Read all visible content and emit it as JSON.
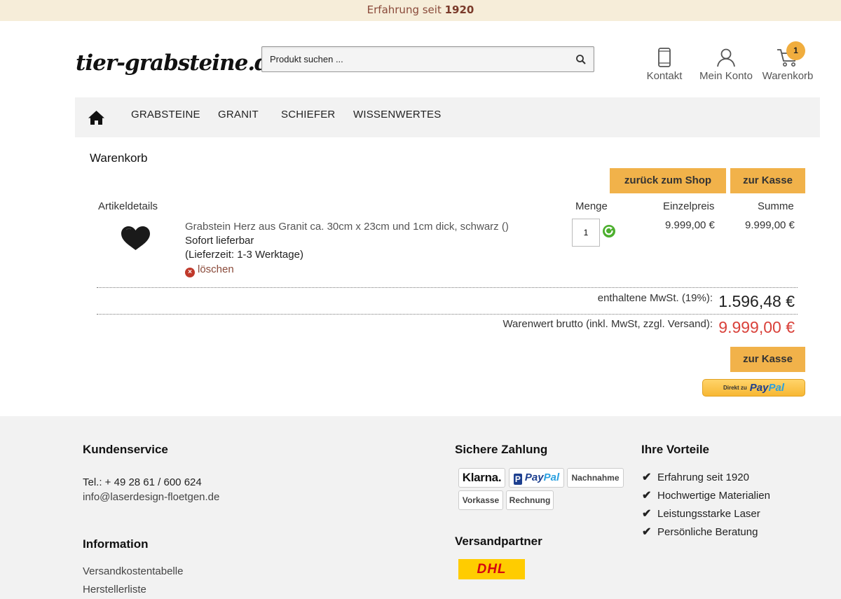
{
  "topbar": {
    "text_prefix": "Erfahrung seit",
    "year": "1920"
  },
  "header": {
    "logo": "tier-grabsteine.de",
    "search_placeholder": "Produkt suchen ...",
    "icons": {
      "contact": "Kontakt",
      "account": "Mein Konto",
      "cart": "Warenkorb"
    },
    "cart_count": "1"
  },
  "nav": {
    "items": [
      "GRABSTEINE",
      "GRANIT",
      "SCHIEFER",
      "WISSENWERTES"
    ]
  },
  "cart": {
    "title": "Warenkorb",
    "buttons": {
      "back": "zurück zum Shop",
      "checkout": "zur Kasse"
    },
    "columns": {
      "details": "Artikeldetails",
      "qty": "Menge",
      "unit": "Einzelpreis",
      "sum": "Summe"
    },
    "item": {
      "name": "Grabstein Herz aus Granit ca. 30cm x 23cm und 1cm dick, schwarz ()",
      "availability": "Sofort lieferbar",
      "delivery": "(Lieferzeit: 1-3 Werktage)",
      "delete": "löschen",
      "qty": "1",
      "unit_price": "9.999,00 €",
      "sum": "9.999,00 €"
    },
    "vat_label": "enthaltene MwSt. (19%):",
    "vat_value": "1.596,48 €",
    "total_label": "Warenwert brutto (inkl. MwSt, zzgl. Versand):",
    "total_value": "9.999,00 €",
    "checkout_bottom": "zur Kasse",
    "paypal": {
      "prefix": "Direkt zu",
      "brand_a": "Pay",
      "brand_b": "Pal"
    }
  },
  "footer": {
    "service": {
      "heading": "Kundenservice",
      "phone": "Tel.: + 49 28 61 / 600 624",
      "email": "info@laserdesign-floetgen.de"
    },
    "info": {
      "heading": "Information",
      "links": [
        "Versandkostentabelle",
        "Herstellerliste"
      ]
    },
    "payment": {
      "heading": "Sichere Zahlung",
      "klarna": "Klarna.",
      "paypal_a": "Pay",
      "paypal_b": "Pal",
      "nachnahme": "Nachnahme",
      "vorkasse": "Vorkasse",
      "rechnung": "Rechnung"
    },
    "shipping": {
      "heading": "Versandpartner",
      "dhl": "DHL"
    },
    "benefits": {
      "heading": "Ihre Vorteile",
      "items": [
        "Erfahrung seit 1920",
        "Hochwertige Materialien",
        "Leistungsstarke Laser",
        "Persönliche Beratung"
      ]
    }
  },
  "colors": {
    "accent_button": "#f1b24a",
    "price_red": "#d9413a",
    "topbar_bg": "#f6edd9"
  }
}
